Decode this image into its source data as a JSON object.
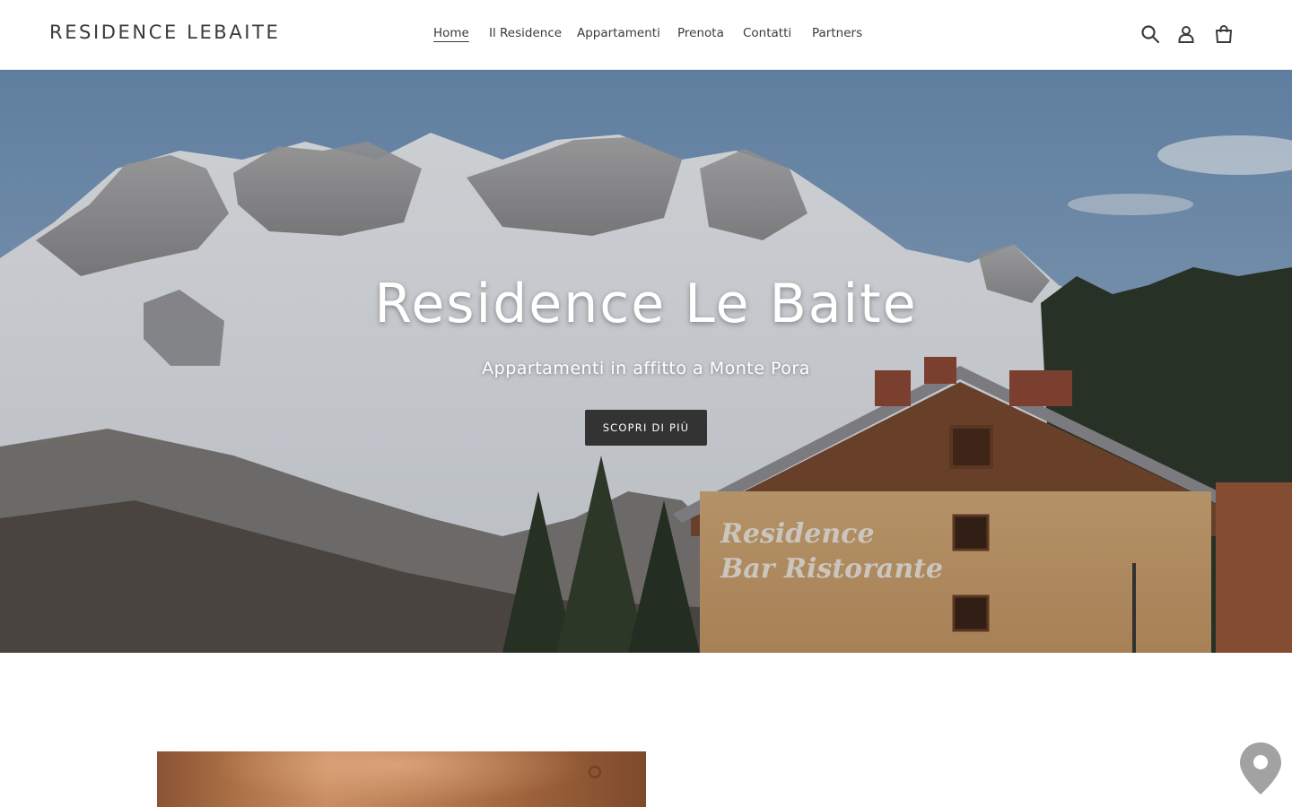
{
  "header": {
    "logo_text": "RESIDENCE LEBAITE",
    "nav": [
      {
        "label": "Home",
        "active": true
      },
      {
        "label": "Il Residence",
        "active": false
      },
      {
        "label": "Appartamenti",
        "active": false
      },
      {
        "label": "Prenota",
        "active": false
      },
      {
        "label": "Contatti",
        "active": false
      },
      {
        "label": "Partners",
        "active": false
      }
    ],
    "icons": [
      "search-icon",
      "account-icon",
      "cart-icon"
    ]
  },
  "hero": {
    "title": "Residence Le Baite",
    "subtitle": "Appartamenti in affitto a Monte Pora",
    "cta_label": "SCOPRI DI PIÙ",
    "sign_line_1": "Residence",
    "sign_line_2": "Bar Ristorante"
  },
  "floating": {
    "icon": "map-pin-icon"
  },
  "colors": {
    "text": "#3a3a3a",
    "button_bg": "#333333",
    "button_text": "#ffffff",
    "building_wall": "#c9a06e",
    "building_wood": "#7a4a30"
  }
}
